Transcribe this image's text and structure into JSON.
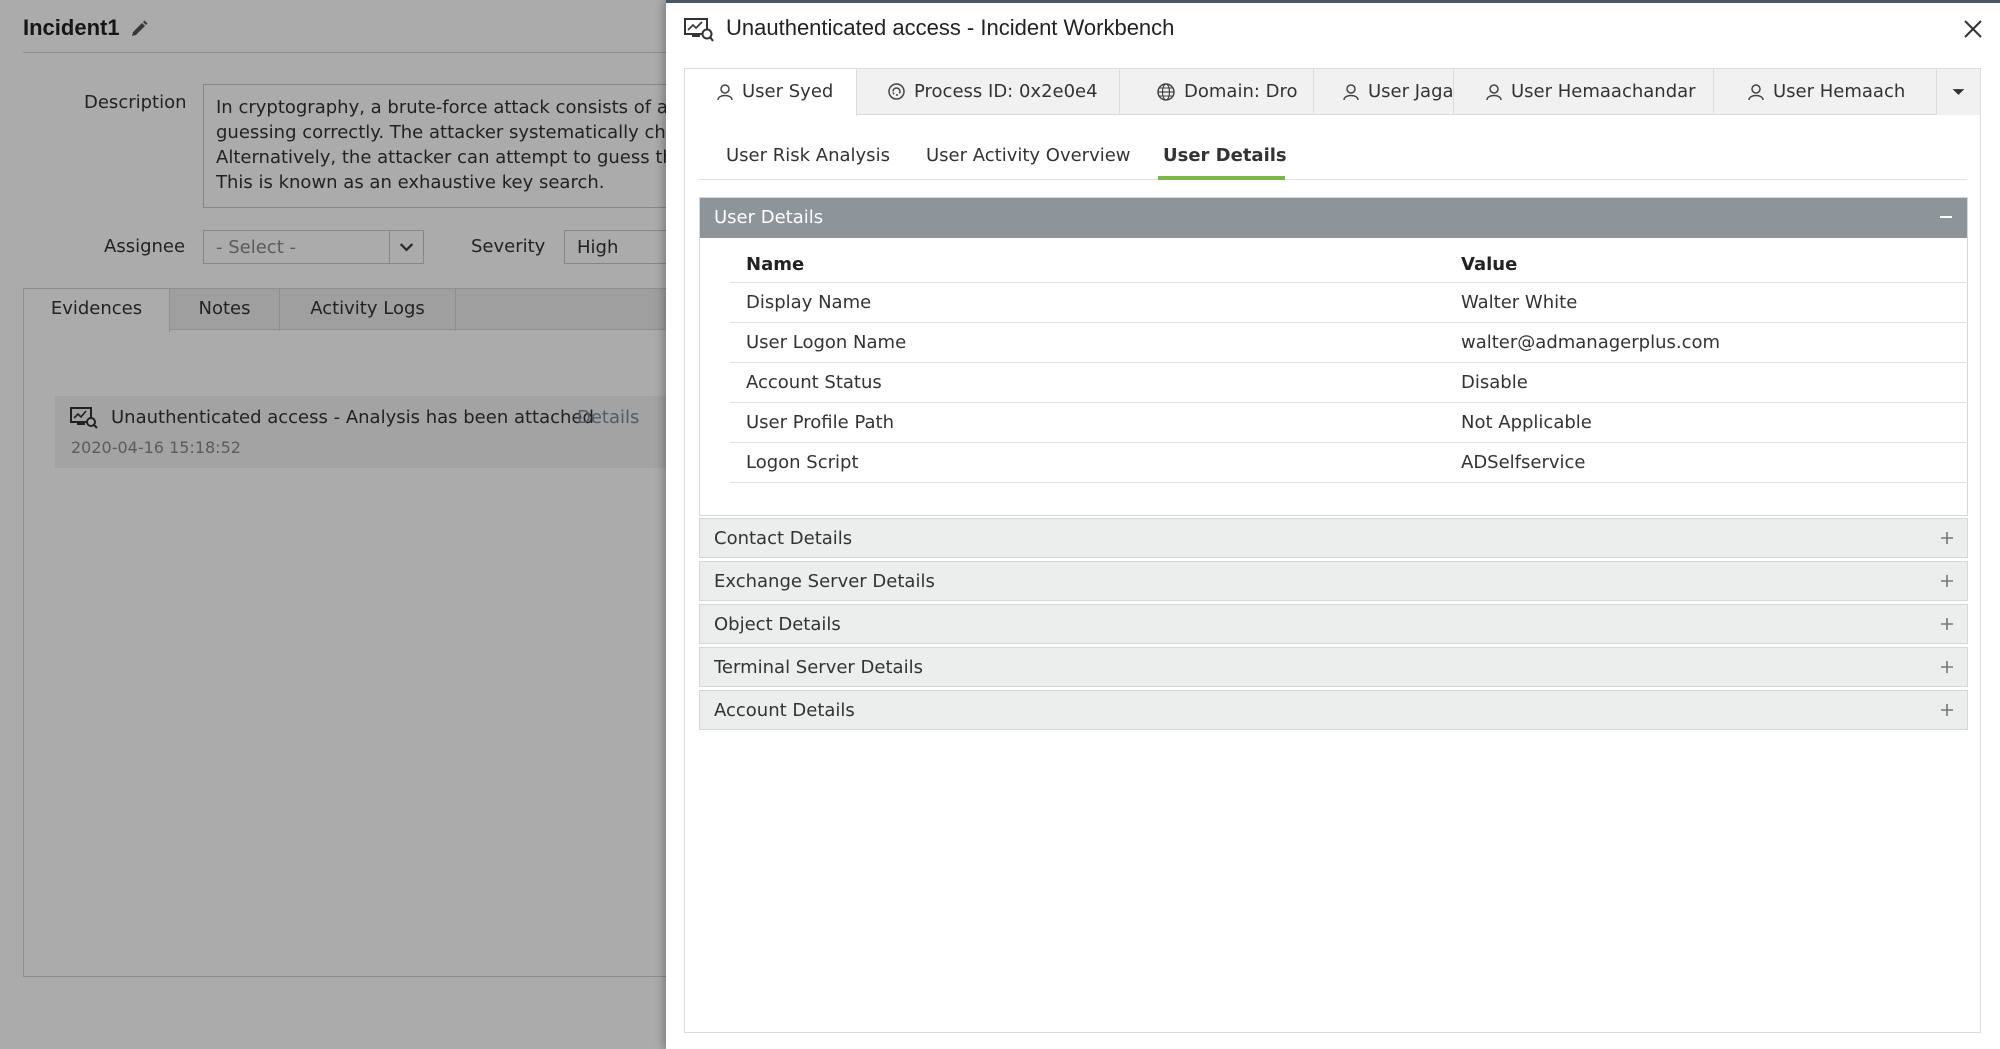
{
  "background": {
    "incident_title": "Incident1",
    "description_label": "Description",
    "description_lines": [
      "In cryptography, a brute-force attack consists of an attacker submitting many passwords or passphrases with the hope of eventually",
      "guessing correctly. The attacker systematically checks all possible passwords and passphrases until the correct one is found.",
      "Alternatively, the attacker can attempt to guess the key which is typically created from the password using a key derivation function.",
      "This is known as an exhaustive key search."
    ],
    "assignee_label": "Assignee",
    "assignee_value": "- Select -",
    "severity_label": "Severity",
    "severity_value": "High",
    "tabs": [
      "Evidences",
      "Notes",
      "Activity Logs"
    ],
    "evidence": {
      "text": "Unauthenticated access - Analysis has been attached",
      "link": "Details",
      "timestamp": "2020-04-16 15:18:52"
    }
  },
  "panel": {
    "title": "Unauthenticated access - Incident Workbench",
    "entity_tabs": [
      {
        "label": "User Syed",
        "icon": "user-icon"
      },
      {
        "label": "Process ID: 0x2e0e4",
        "icon": "process-icon"
      },
      {
        "label": "Domain: Dro",
        "icon": "globe-icon"
      },
      {
        "label": "User Jaga",
        "icon": "user-icon"
      },
      {
        "label": "User Hemaachandar",
        "icon": "user-icon"
      },
      {
        "label": "User Hemaach",
        "icon": "user-icon"
      }
    ],
    "sub_tabs": [
      "User Risk Analysis",
      "User Activity Overview",
      "User Details"
    ],
    "user_details": {
      "header": "User Details",
      "col_name": "Name",
      "col_value": "Value",
      "rows": [
        {
          "name": "Display Name",
          "value": "Walter White"
        },
        {
          "name": "User Logon Name",
          "value": "walter@admanagerplus.com"
        },
        {
          "name": "Account Status",
          "value": "Disable"
        },
        {
          "name": "User Profile Path",
          "value": "Not Applicable"
        },
        {
          "name": "Logon Script",
          "value": "ADSelfservice"
        }
      ]
    },
    "collapsed_sections": [
      "Contact Details",
      "Exchange Server Details",
      "Object Details",
      "Terminal Server Details",
      "Account Details"
    ],
    "colors": {
      "accent_underline": "#7ab648",
      "section_header": "#8d959b"
    }
  }
}
